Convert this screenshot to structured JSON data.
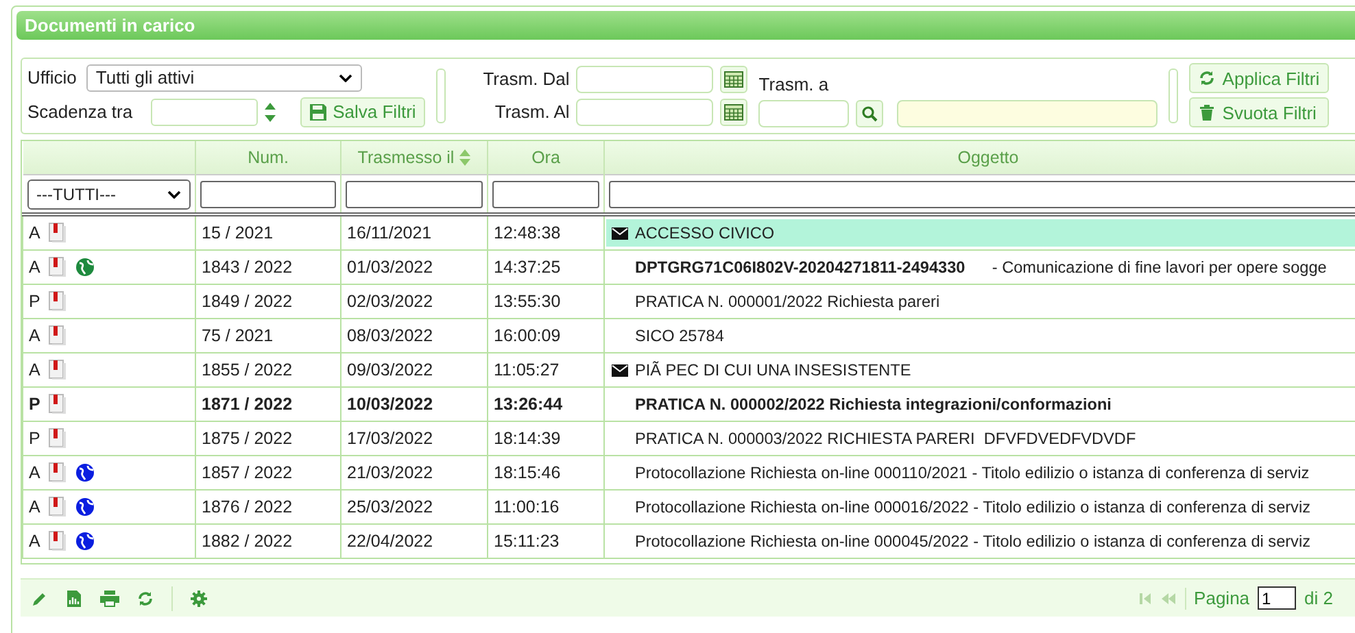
{
  "panel": {
    "title": "Documenti in carico"
  },
  "filters": {
    "ufficio_label": "Ufficio",
    "ufficio_value": "Tutti gli attivi",
    "scadenza_label": "Scadenza tra",
    "save_button": "Salva Filtri",
    "dal_label": "Trasm. Dal",
    "al_label": "Trasm. Al",
    "a_label": "Trasm. a",
    "apply_button": "Applica Filtri",
    "clear_button": "Svuota Filtri"
  },
  "table": {
    "columns": [
      {
        "kind": "select",
        "filter_value": "---TUTTI---"
      },
      {
        "label": "Num.",
        "kind": "text"
      },
      {
        "label": "Trasmesso il",
        "kind": "text",
        "sorted": true
      },
      {
        "label": "Ora",
        "kind": "text"
      },
      {
        "label": "Oggetto",
        "kind": "text"
      }
    ],
    "rows": [
      {
        "type": "A",
        "num": "15 / 2021",
        "date": "16/11/2021",
        "time": "12:48:38",
        "mail": true,
        "subject": "ACCESSO CIVICO",
        "highlighted": true,
        "bold": false
      },
      {
        "type": "A",
        "color": "#1e8a3e",
        "num": "1843 / 2022",
        "date": "01/03/2022",
        "time": "14:37:25",
        "mail": false,
        "subject": "**DPTGRG71C06I802V-20204271811-2494330**      - Comunicazione di fine lavori per opere sogge",
        "highlighted": false,
        "bold": false
      },
      {
        "type": "P",
        "num": "1849 / 2022",
        "date": "02/03/2022",
        "time": "13:55:30",
        "mail": false,
        "subject": "PRATICA N. 000001/2022 Richiesta pareri",
        "highlighted": false,
        "bold": false
      },
      {
        "type": "A",
        "num": "75 / 2021",
        "date": "08/03/2022",
        "time": "16:00:09",
        "mail": false,
        "subject": "SICO 25784",
        "highlighted": false,
        "bold": false
      },
      {
        "type": "A",
        "num": "1855 / 2022",
        "date": "09/03/2022",
        "time": "11:05:27",
        "mail": true,
        "subject": "PIÃ PEC DI CUI UNA INSESISTENTE",
        "highlighted": false,
        "bold": false
      },
      {
        "type": "P",
        "num": "1871 / 2022",
        "date": "10/03/2022",
        "time": "13:26:44",
        "mail": false,
        "subject": "PRATICA N. 000002/2022 Richiesta integrazioni/conformazioni",
        "highlighted": false,
        "bold": true
      },
      {
        "type": "P",
        "num": "1875 / 2022",
        "date": "17/03/2022",
        "time": "18:14:39",
        "mail": false,
        "subject": "PRATICA N. 000003/2022 RICHIESTA PARERI  DFVFDVEDFVDVDF",
        "highlighted": false,
        "bold": false
      },
      {
        "type": "A",
        "color": "#0a1ee0",
        "num": "1857 / 2022",
        "date": "21/03/2022",
        "time": "18:15:46",
        "mail": false,
        "subject": "Protocollazione Richiesta on-line 000110/2021 - Titolo edilizio o istanza di conferenza di serviz",
        "highlighted": false,
        "bold": false
      },
      {
        "type": "A",
        "color": "#0a1ee0",
        "num": "1876 / 2022",
        "date": "25/03/2022",
        "time": "11:00:16",
        "mail": false,
        "subject": "Protocollazione Richiesta on-line 000016/2022 - Titolo edilizio o istanza di conferenza di serviz",
        "highlighted": false,
        "bold": false
      },
      {
        "type": "A",
        "color": "#0a1ee0",
        "num": "1882 / 2022",
        "date": "22/04/2022",
        "time": "15:11:23",
        "mail": false,
        "subject": "Protocollazione Richiesta on-line 000045/2022 - Titolo edilizio o istanza di conferenza di serviz",
        "highlighted": false,
        "bold": false
      }
    ]
  },
  "pager": {
    "label": "Pagina",
    "page": "1",
    "total": "di 2"
  }
}
